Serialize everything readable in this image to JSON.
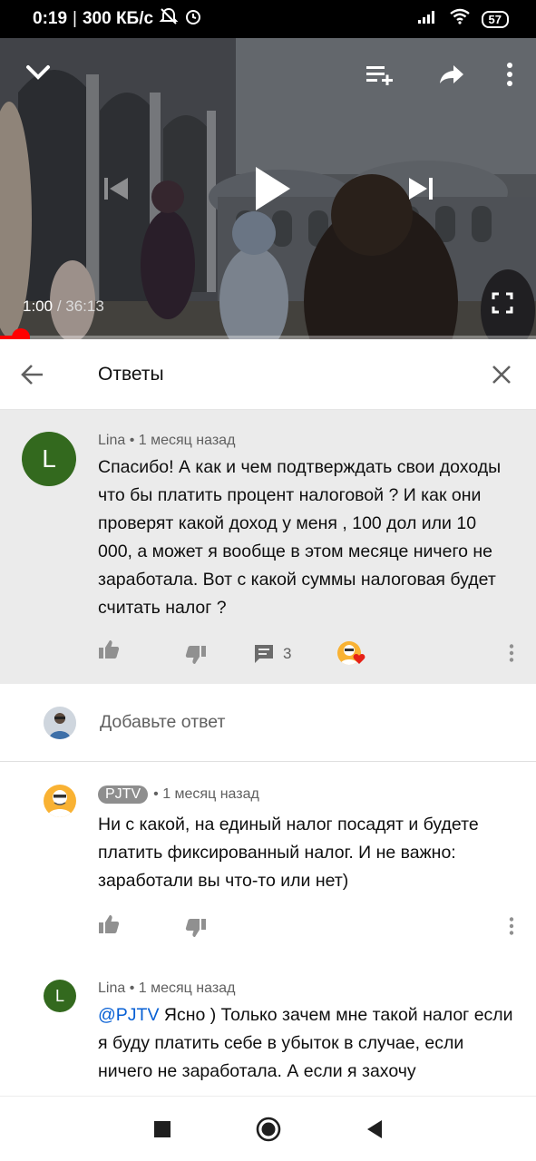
{
  "status_bar": {
    "time": "0:19",
    "separator": "|",
    "speed": "300 КБ/с",
    "battery": "57"
  },
  "player": {
    "current_time": "1:00",
    "time_separator": " / ",
    "duration": "36:13",
    "progress_fraction": 0.028,
    "icons": {
      "collapse": "chevron-down-icon",
      "queue": "add-to-queue-icon",
      "share": "share-icon",
      "more": "more-vert-icon",
      "previous": "skip-previous-icon",
      "play": "play-icon",
      "next": "skip-next-icon",
      "fullscreen": "fullscreen-icon"
    }
  },
  "replies_header": {
    "title": "Ответы"
  },
  "main_comment": {
    "avatar_letter": "L",
    "avatar_color": "#33691e",
    "author": "Lina",
    "dot": "•",
    "time": "1 месяц назад",
    "text": "Спасибо! А как и чем подтверждать свои доходы что бы платить процент налоговой ? И как они проверят какой доход у меня , 100 дол или  10 000, а может я вообще в этом месяце ничего не заработала. Вот с какой суммы налоговая будет считать налог ?",
    "reply_count": "3"
  },
  "add_reply": {
    "placeholder": "Добавьте ответ"
  },
  "replies": [
    {
      "author": "PJTV",
      "dot": "•",
      "time": "1 месяц назад",
      "text": "Ни с какой, на единый налог посадят и будете платить фиксированный налог. И не важно: заработали вы что-то или нет)"
    },
    {
      "avatar_letter": "L",
      "author": "Lina",
      "dot": "•",
      "time": "1 месяц назад",
      "mention": "@PJTV",
      "text": " Ясно ) Только зачем мне такой налог если я буду платить себе в убыток в случае, если ничего не заработала. А если я захочу"
    }
  ],
  "colors": {
    "accent_red": "#ff0000",
    "link_blue": "#065fd4",
    "highlight_bg": "#ebebeb",
    "lina_avatar": "#33691e",
    "pjtv_avatar": "#f9b233"
  }
}
